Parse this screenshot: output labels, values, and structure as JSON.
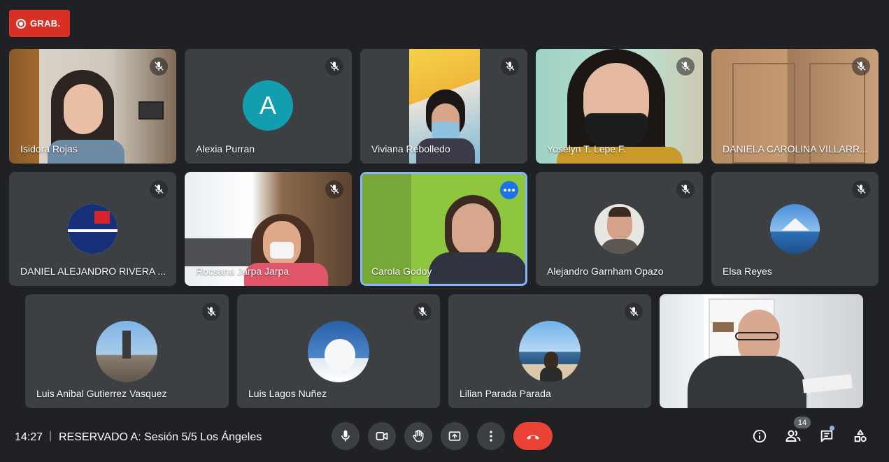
{
  "recording": {
    "label": "GRAB."
  },
  "participants": [
    {
      "name": "Isidora Rojas"
    },
    {
      "name": "Alexia Purran",
      "initial": "A"
    },
    {
      "name": "Viviana Rebolledo"
    },
    {
      "name": "Yoselyn T. Lepe F."
    },
    {
      "name": "DANIELA CAROLINA VILLARR..."
    },
    {
      "name": "DANIEL ALEJANDRO RIVERA ..."
    },
    {
      "name": "Rocsana Jarpa Jarpa"
    },
    {
      "name": "Carola Godoy"
    },
    {
      "name": "Alejandro Garnham Opazo"
    },
    {
      "name": "Elsa Reyes"
    },
    {
      "name": "Luis Anibal Gutierrez Vasquez"
    },
    {
      "name": "Luis Lagos Nuñez"
    },
    {
      "name": "Lilian Parada Parada"
    }
  ],
  "bottom_bar": {
    "time": "14:27",
    "separator": "|",
    "meeting_title": "RESERVADO A: Sesión 5/5 Los Ángeles",
    "participant_count": "14"
  },
  "colors": {
    "background": "#202124",
    "tile": "#3c4043",
    "record_red": "#d93025",
    "hangup_red": "#ea4335",
    "active_border": "#8ab4f8",
    "avatar_teal": "#129eaf"
  }
}
